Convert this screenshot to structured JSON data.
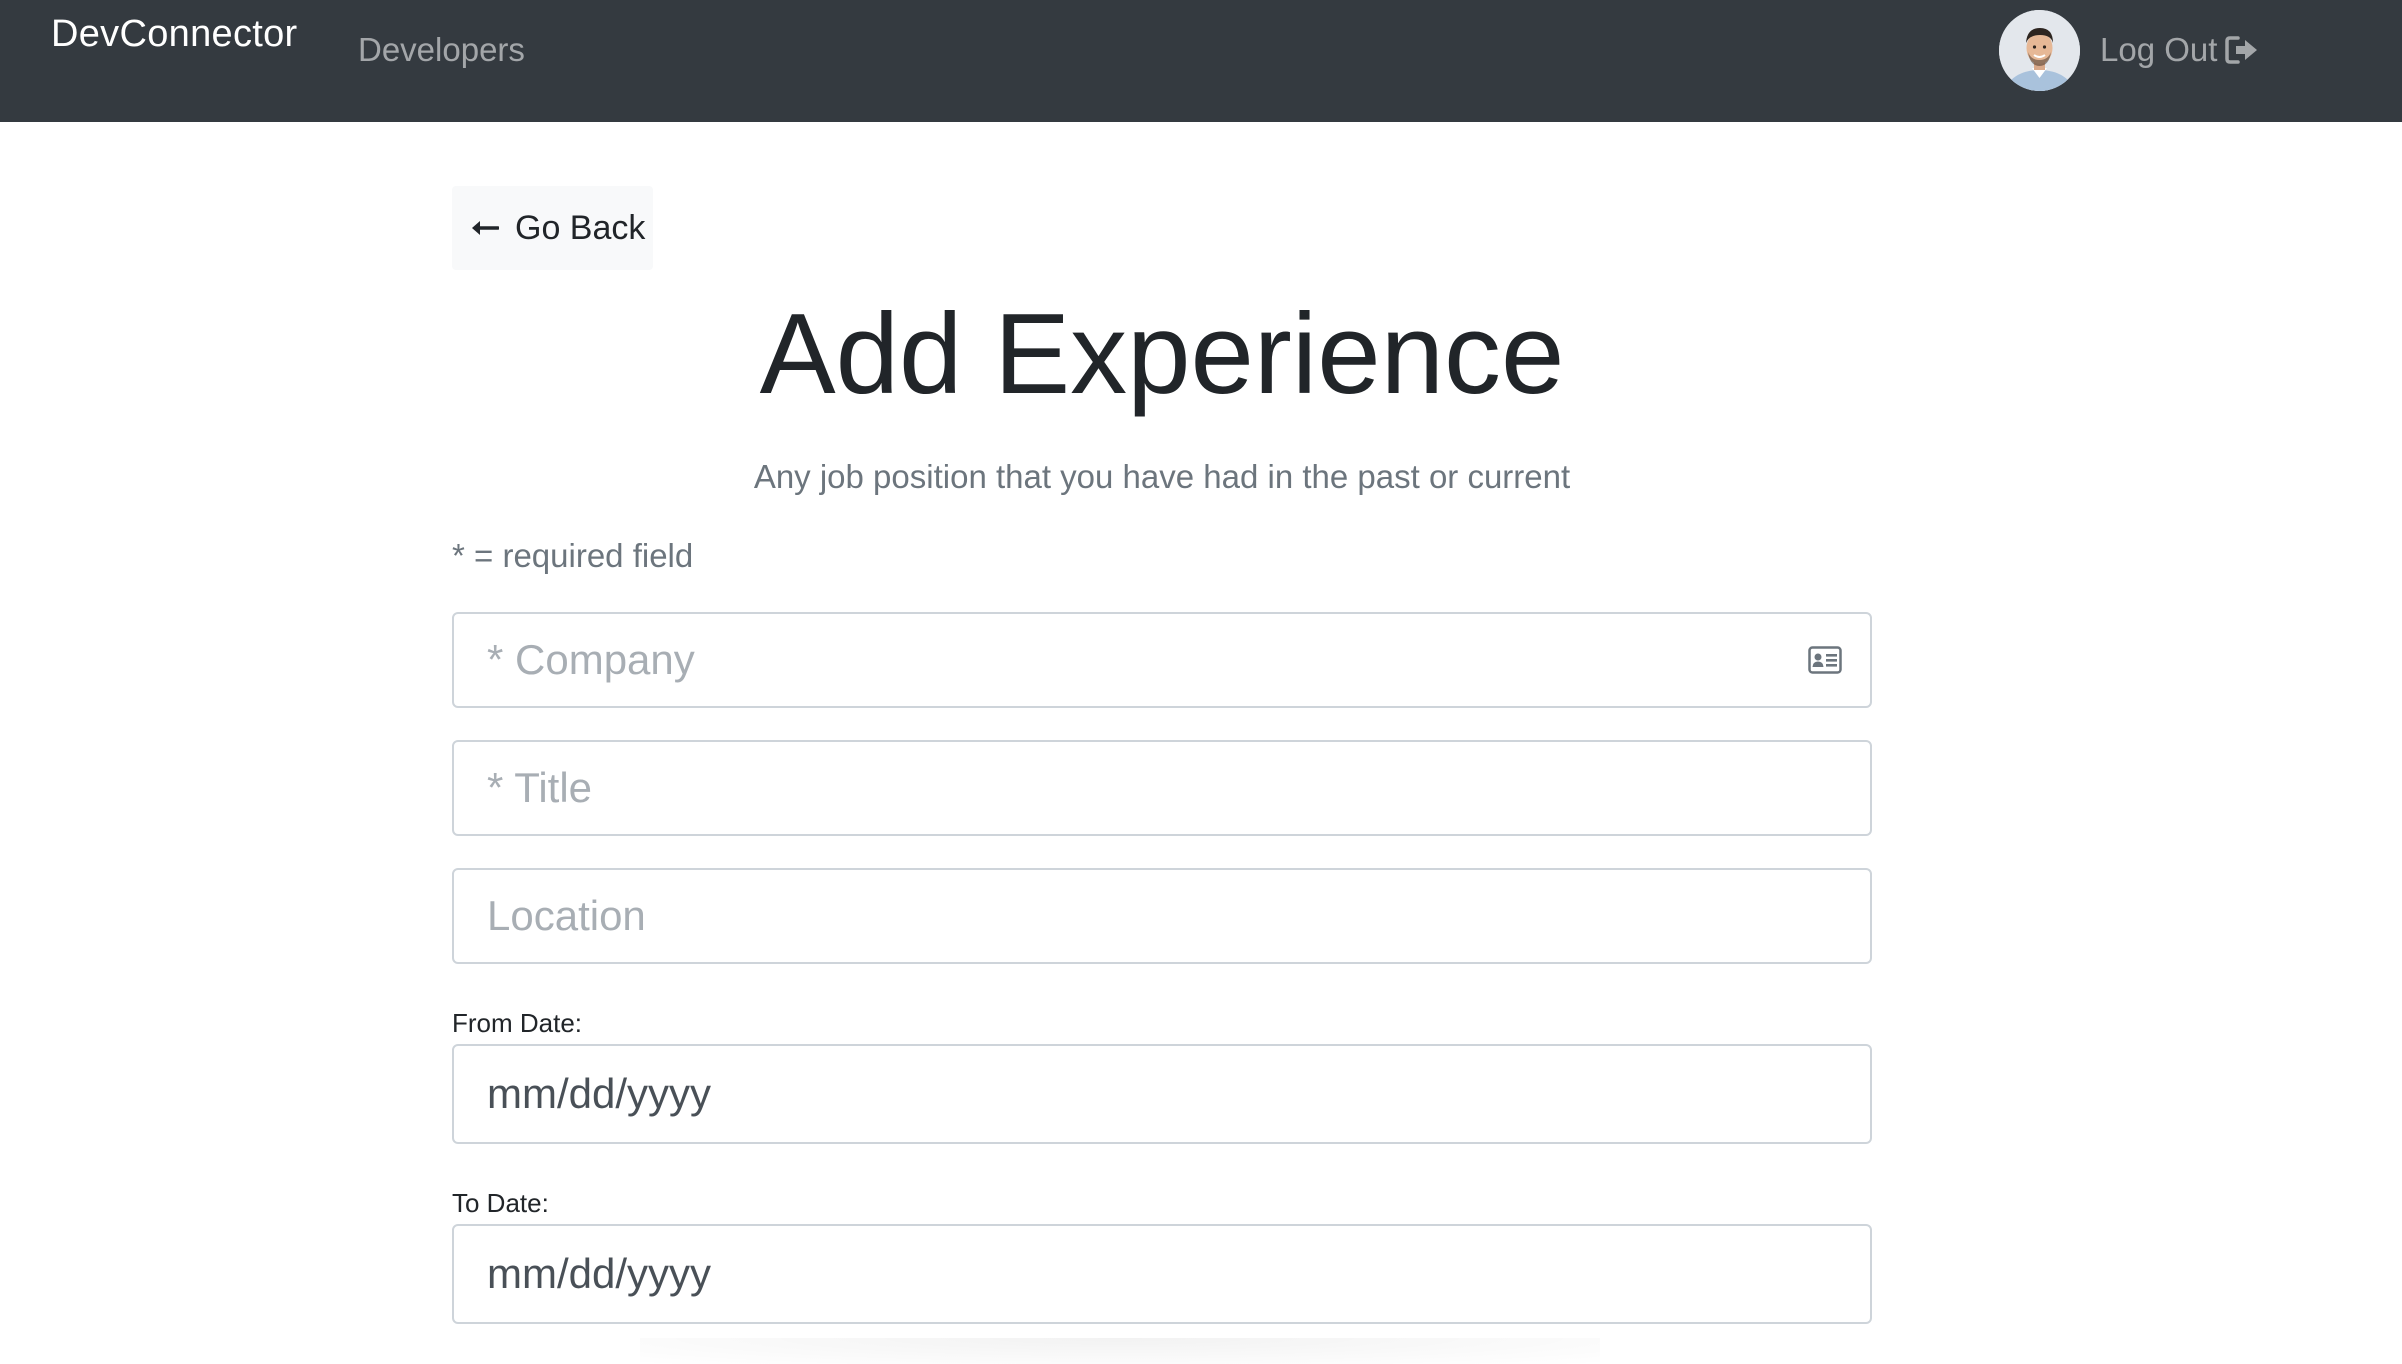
{
  "navbar": {
    "brand": "DevConnector",
    "links": [
      {
        "label": "Developers"
      }
    ],
    "logout_label": "Log Out",
    "logout_icon": "sign-out-icon",
    "background": "#343a40"
  },
  "go_back": {
    "label": "Go Back",
    "icon": "arrow-left-icon"
  },
  "page": {
    "title": "Add Experience",
    "lead": "Any job position that you have had in the past or current",
    "required_note": "* = required field"
  },
  "form": {
    "company": {
      "placeholder": "* Company",
      "value": "",
      "icon": "id-card-icon"
    },
    "title": {
      "placeholder": "* Title",
      "value": ""
    },
    "location": {
      "placeholder": "Location",
      "value": ""
    },
    "from_date": {
      "label": "From Date:",
      "value": "mm/dd/yyyy"
    },
    "to_date": {
      "label": "To Date:",
      "value": "mm/dd/yyyy"
    }
  }
}
